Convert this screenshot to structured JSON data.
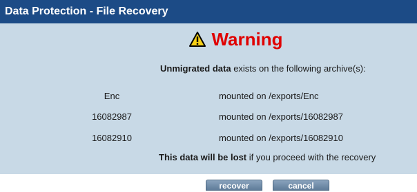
{
  "window": {
    "title": "Data Protection - File Recovery"
  },
  "warning": {
    "icon": "warning-triangle-icon",
    "heading": "Warning",
    "heading_color": "#e00000"
  },
  "message": {
    "intro_bold": "Unmigrated data",
    "intro_rest": " exists on the following archive(s):",
    "footer_bold": "This data will be lost",
    "footer_rest": " if you proceed with the recovery"
  },
  "archives": [
    {
      "name": "Enc",
      "mount": "mounted on /exports/Enc"
    },
    {
      "name": "16082987",
      "mount": "mounted on /exports/16082987"
    },
    {
      "name": "16082910",
      "mount": "mounted on /exports/16082910"
    }
  ],
  "buttons": {
    "recover_label": "recover",
    "cancel_label": "cancel"
  },
  "colors": {
    "titlebar": "#1c4b86",
    "panel": "#c8d9e6",
    "button": "#6f8aa6"
  }
}
